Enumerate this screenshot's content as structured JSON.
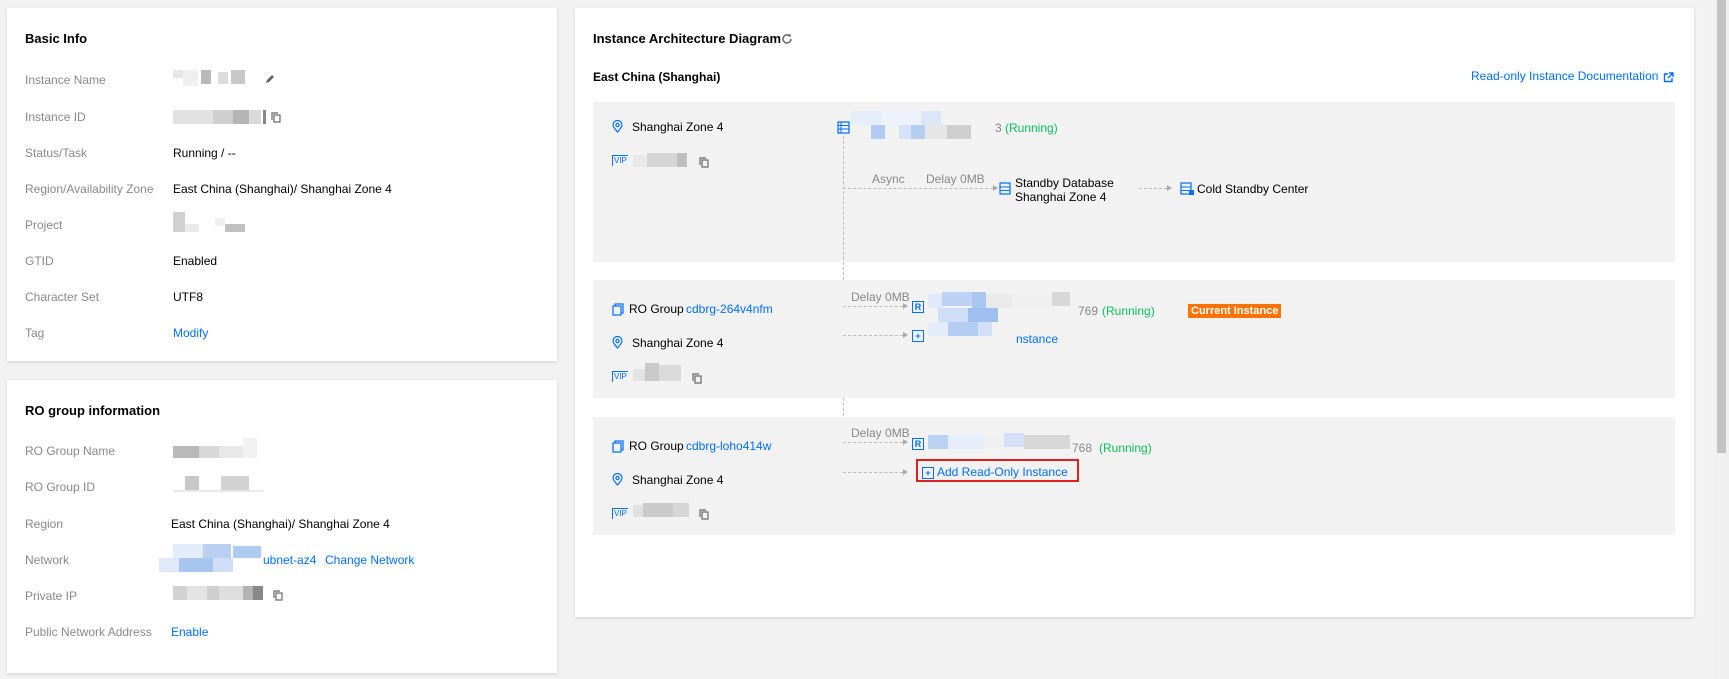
{
  "basic_info": {
    "title": "Basic Info",
    "rows": [
      {
        "label": "Instance Name",
        "value": ""
      },
      {
        "label": "Instance ID",
        "value": ""
      },
      {
        "label": "Status/Task",
        "value": "Running / --"
      },
      {
        "label": "Region/Availability Zone",
        "value": "East China (Shanghai)/ Shanghai Zone 4"
      },
      {
        "label": "Project",
        "value": ""
      },
      {
        "label": "GTID",
        "value": "Enabled"
      },
      {
        "label": "Character Set",
        "value": "UTF8"
      },
      {
        "label": "Tag",
        "value": "Modify"
      }
    ]
  },
  "ro_group_info": {
    "title": "RO group information",
    "rows": [
      {
        "label": "RO Group Name",
        "value": ""
      },
      {
        "label": "RO Group ID",
        "value": ""
      },
      {
        "label": "Region",
        "value": "East China (Shanghai)/ Shanghai Zone 4"
      },
      {
        "label": "Network",
        "value": "ubnet-az4",
        "action": "Change Network"
      },
      {
        "label": "Private IP",
        "value": ""
      },
      {
        "label": "Public Network Address",
        "value": "Enable"
      }
    ]
  },
  "diagram": {
    "title": "Instance Architecture Diagram",
    "region": "East China (Shanghai)",
    "doc_link": "Read-only Instance Documentation",
    "master": {
      "zone": "Shanghai Zone 4",
      "vip_badge": "VIP",
      "id_tail": "3",
      "status": "(Running)",
      "async_label": "Async",
      "delay_label": "Delay 0MB",
      "standby_title": "Standby Database",
      "standby_zone": "Shanghai Zone 4",
      "cold_standby": "Cold Standby Center"
    },
    "ro_groups": [
      {
        "prefix": "RO Group",
        "group_id": "cdbrg-264v4nfm",
        "zone": "Shanghai Zone 4",
        "vip_badge": "VIP",
        "delay_label": "Delay 0MB",
        "instance_tail": "769",
        "status": "(Running)",
        "current_badge": "Current Instance",
        "add_tail": "nstance"
      },
      {
        "prefix": "RO Group",
        "group_id": "cdbrg-loho414w",
        "zone": "Shanghai Zone 4",
        "vip_badge": "VIP",
        "delay_label": "Delay 0MB",
        "instance_tail": "768",
        "status": "(Running)",
        "add_label": "Add Read-Only Instance"
      }
    ]
  },
  "colors": {
    "link": "#006eff",
    "running": "#0abf5b",
    "current_badge_bg": "#ff7200",
    "highlight_border": "#e02020",
    "panel_bg": "#f2f2f2"
  },
  "icons": [
    "edit-icon",
    "copy-icon",
    "location-icon",
    "refresh-icon",
    "external-link-icon",
    "instance-icon",
    "ro-group-icon",
    "vip-icon"
  ]
}
